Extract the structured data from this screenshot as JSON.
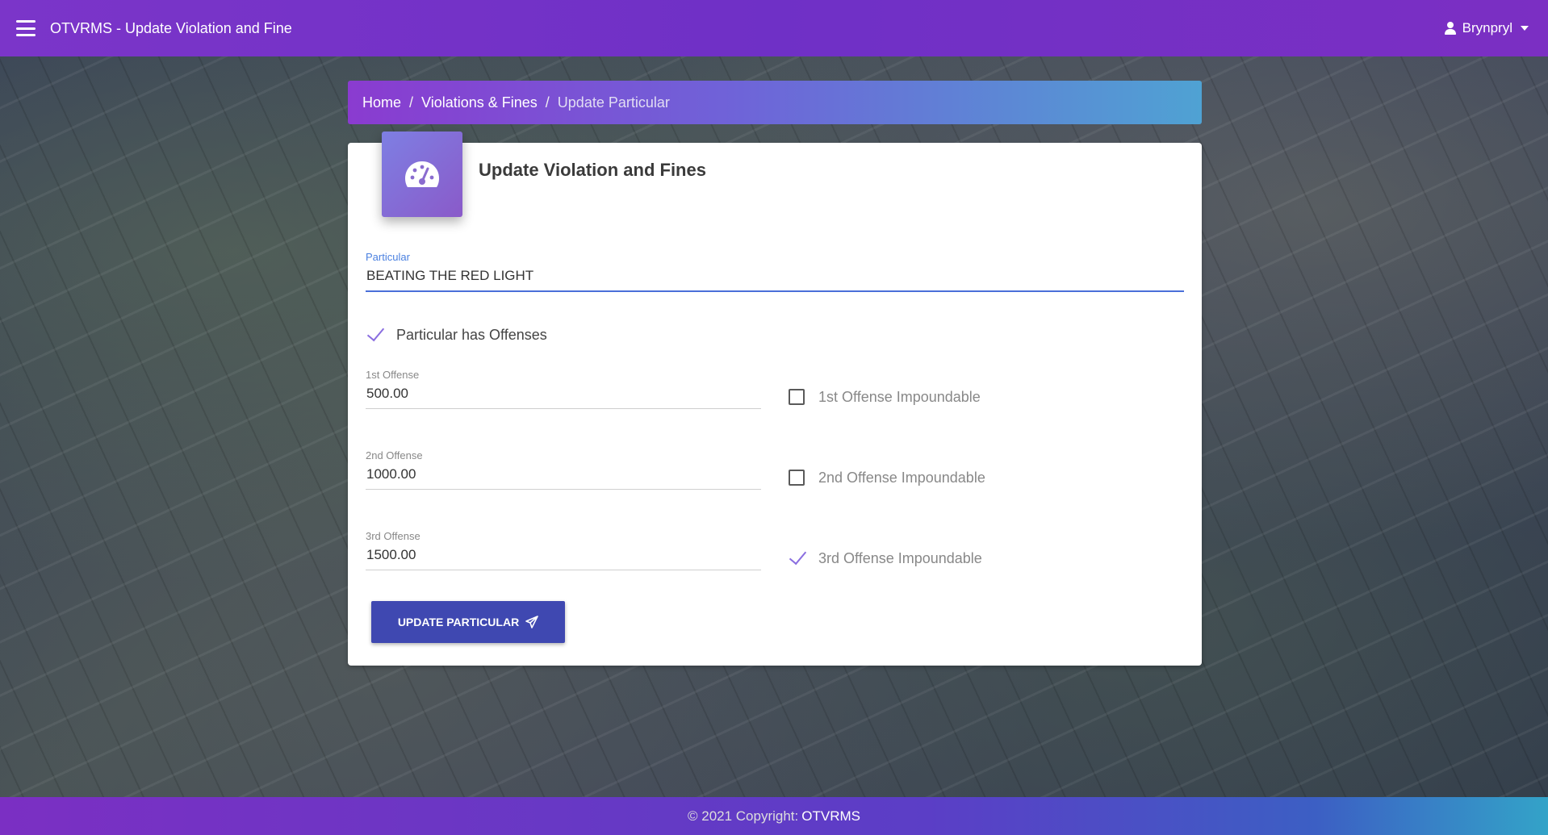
{
  "navbar": {
    "title": "OTVRMS - Update Violation and Fine",
    "user": "Brynpryl"
  },
  "breadcrumb": {
    "home": "Home",
    "section": "Violations & Fines",
    "current": "Update Particular",
    "separator": "/"
  },
  "card": {
    "title": "Update Violation and Fines",
    "icon": "tachometer-icon"
  },
  "form": {
    "particular": {
      "label": "Particular",
      "value": "BEATING THE RED LIGHT"
    },
    "has_offenses": {
      "label": "Particular has Offenses",
      "checked": true
    },
    "offenses": [
      {
        "label": "1st Offense",
        "value": "500.00",
        "impoundable_label": "1st Offense Impoundable",
        "impoundable": false
      },
      {
        "label": "2nd Offense",
        "value": "1000.00",
        "impoundable_label": "2nd Offense Impoundable",
        "impoundable": false
      },
      {
        "label": "3rd Offense",
        "value": "1500.00",
        "impoundable_label": "3rd Offense Impoundable",
        "impoundable": true
      }
    ],
    "submit_label": "UPDATE PARTICULAR"
  },
  "footer": {
    "text": "© 2021 Copyright:",
    "brand": "OTVRMS"
  },
  "colors": {
    "navbar": "#7b35c9",
    "button": "#3f48b1",
    "check": "#8a6ee0",
    "focus_underline": "#4a6fd9"
  }
}
